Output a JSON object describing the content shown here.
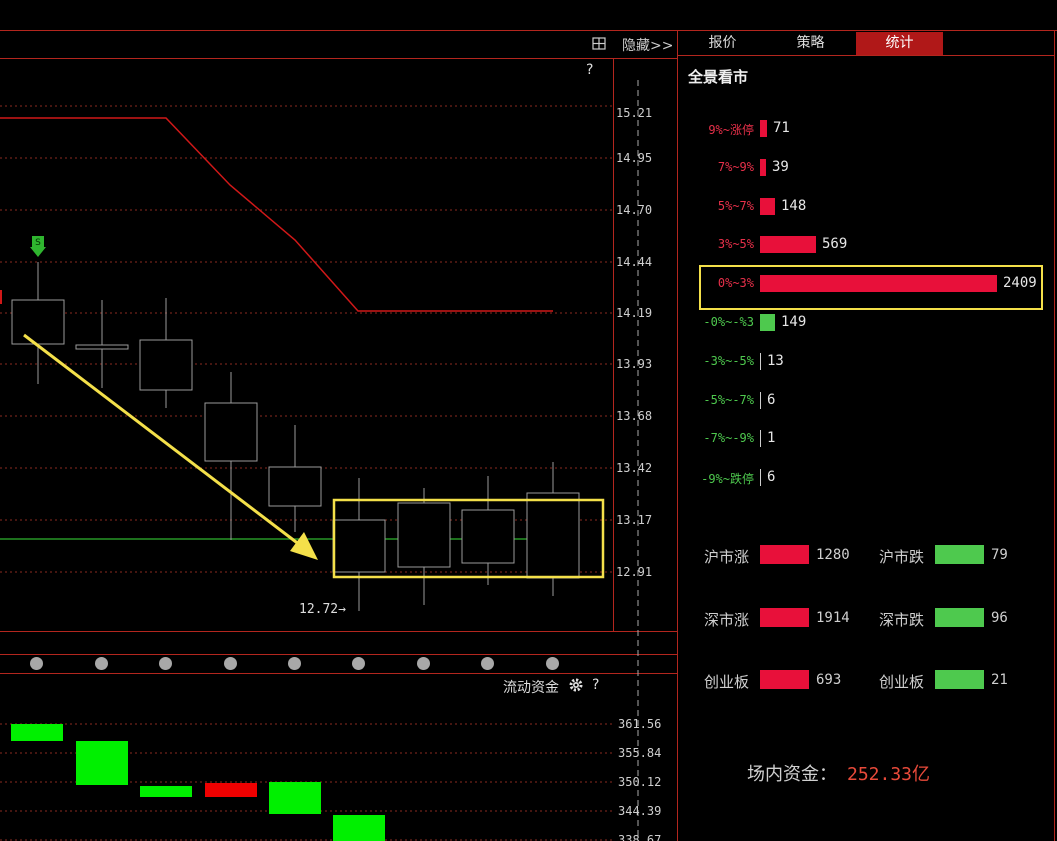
{
  "toolbar": {
    "hide_label": "隐藏>>",
    "grid_icon": "grid-icon"
  },
  "tabs": [
    {
      "label": "报价",
      "active": false
    },
    {
      "label": "策略",
      "active": false
    },
    {
      "label": "统计",
      "active": true
    }
  ],
  "chart": {
    "help": "?",
    "price_axis": [
      "15.21",
      "14.95",
      "14.70",
      "14.44",
      "14.19",
      "13.93",
      "13.68",
      "13.42",
      "13.17",
      "12.91"
    ],
    "low_marker": "12.72→",
    "signal_icon": "sell-signal-icon",
    "signal_letter": "S"
  },
  "flow": {
    "title": "流动资金",
    "gear_icon": "gear-icon",
    "help": "?",
    "axis": [
      "361.56",
      "355.84",
      "350.12",
      "344.39",
      "338.67"
    ]
  },
  "panorama": {
    "title": "全景看市",
    "up_color": "#e8103a",
    "down_color": "#4ec94e",
    "rows": [
      {
        "label": "9%~涨停",
        "value": "71",
        "count": 71,
        "dir": "up"
      },
      {
        "label": "7%~9%",
        "value": "39",
        "count": 39,
        "dir": "up"
      },
      {
        "label": "5%~7%",
        "value": "148",
        "count": 148,
        "dir": "up"
      },
      {
        "label": "3%~5%",
        "value": "569",
        "count": 569,
        "dir": "up"
      },
      {
        "label": "0%~3%",
        "value": "2409",
        "count": 2409,
        "dir": "up",
        "highlighted": true
      },
      {
        "label": "-0%~-%3",
        "value": "149",
        "count": 149,
        "dir": "down"
      },
      {
        "label": "-3%~-5%",
        "value": "13",
        "count": 13,
        "dir": "down"
      },
      {
        "label": "-5%~-7%",
        "value": "6",
        "count": 6,
        "dir": "down"
      },
      {
        "label": "-7%~-9%",
        "value": "1",
        "count": 1,
        "dir": "down"
      },
      {
        "label": "-9%~跌停",
        "value": "6",
        "count": 6,
        "dir": "down"
      }
    ]
  },
  "markets": [
    {
      "up_label": "沪市涨",
      "up_value": "1280",
      "down_label": "沪市跌",
      "down_value": "79"
    },
    {
      "up_label": "深市涨",
      "up_value": "1914",
      "down_label": "深市跌",
      "down_value": "96"
    },
    {
      "up_label": "创业板",
      "up_value": "693",
      "down_label": "创业板",
      "down_value": "21"
    }
  ],
  "funds": {
    "label": "场内资金：",
    "value": "252.33亿"
  }
}
